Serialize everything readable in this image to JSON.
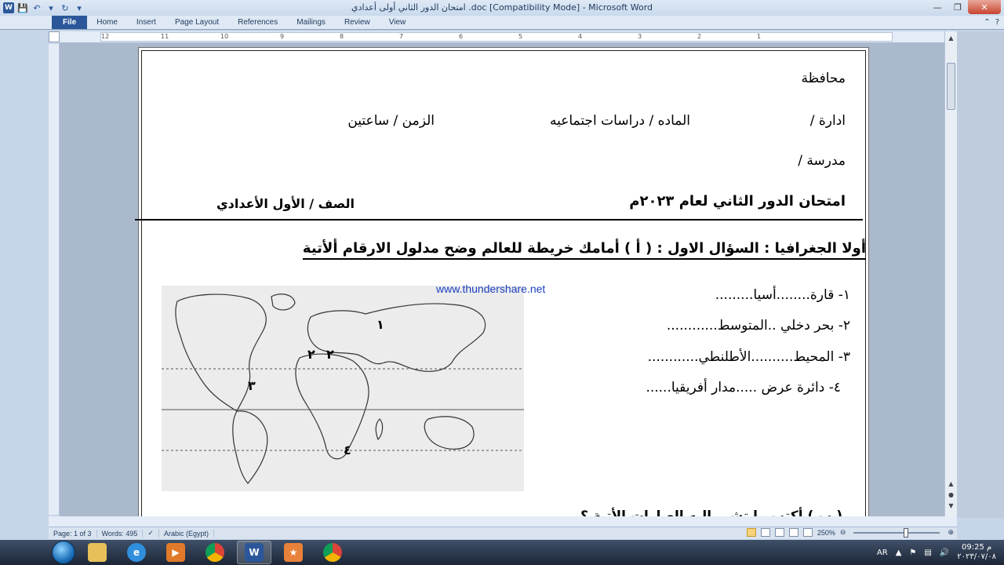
{
  "window": {
    "title": "امتحان الدور الثاني أولى أعدادي .doc [Compatibility Mode]  -  Microsoft Word"
  },
  "ribbon": {
    "tabs": [
      "File",
      "Home",
      "Insert",
      "Page Layout",
      "References",
      "Mailings",
      "Review",
      "View"
    ]
  },
  "ruler": {
    "numbers": [
      "12",
      "11",
      "10",
      "9",
      "8",
      "7",
      "6",
      "5",
      "4",
      "3",
      "2",
      "1"
    ]
  },
  "document": {
    "governorate": "محافظة",
    "administration": "ادارة /",
    "subject": "الماده / دراسات اجتماعيه",
    "time": "الزمن / ساعتين",
    "school": "مدرسة /",
    "exam_title": "امتحان الدور الثاني  لعام ٢٠٢٣م",
    "grade": "الصف / الأول الأعدادي",
    "question_title": "أولا الجغرافيا : السؤال الاول : ( أ ) أمامك خريطة للعالم وضح مدلول الارقام ألأتية",
    "answers": [
      "١-  قارة........أسيا.........",
      "٢-  بحر دخلي    ..المتوسط............",
      "٣-  المحيط..........الأطلنطي............",
      "٤- دائرة عرض .....مدار أفريقيا......"
    ],
    "next_question_partial": "( ب ) أكتب ما تشير إليه العبارات الأتية ؟",
    "watermark": "www.thundershare.net",
    "map_numbers": [
      "١",
      "٢",
      "٢",
      "٣",
      "٤"
    ]
  },
  "statusbar": {
    "page": "Page: 1 of 3",
    "words": "Words: 495",
    "language": "Arabic (Egypt)",
    "zoom": "250%"
  },
  "taskbar": {
    "lang": "AR",
    "time": "09:25 م",
    "date": "٢٠٢٣/٠٧/٠٨"
  }
}
